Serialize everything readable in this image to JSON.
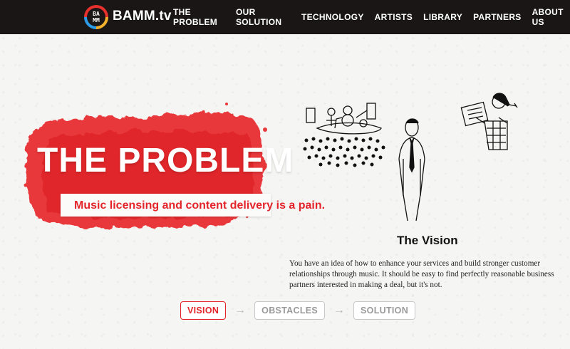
{
  "brand": {
    "logo_text": [
      "BA",
      "MM"
    ],
    "name": "BAMM.tv"
  },
  "nav": [
    {
      "label": "THE PROBLEM"
    },
    {
      "label": "OUR SOLUTION"
    },
    {
      "label": "TECHNOLOGY"
    },
    {
      "label": "ARTISTS"
    },
    {
      "label": "LIBRARY"
    },
    {
      "label": "PARTNERS"
    },
    {
      "label": "ABOUT US"
    }
  ],
  "hero": {
    "title": "THE PROBLEM",
    "subtitle": "Music licensing and content delivery is a pain."
  },
  "vision": {
    "heading": "The Vision",
    "body": "You have an idea of how to enhance your services and build stronger customer relationships through music. It should be easy to find perfectly reasonable business partners interested in making a deal, but it's not."
  },
  "steps": [
    {
      "label": "VISION",
      "active": true
    },
    {
      "label": "OBSTACLES",
      "active": false
    },
    {
      "label": "SOLUTION",
      "active": false
    }
  ],
  "colors": {
    "accent": "#e3252b",
    "nav_bg": "#1a1616"
  },
  "icons": {
    "arrow": "→"
  }
}
